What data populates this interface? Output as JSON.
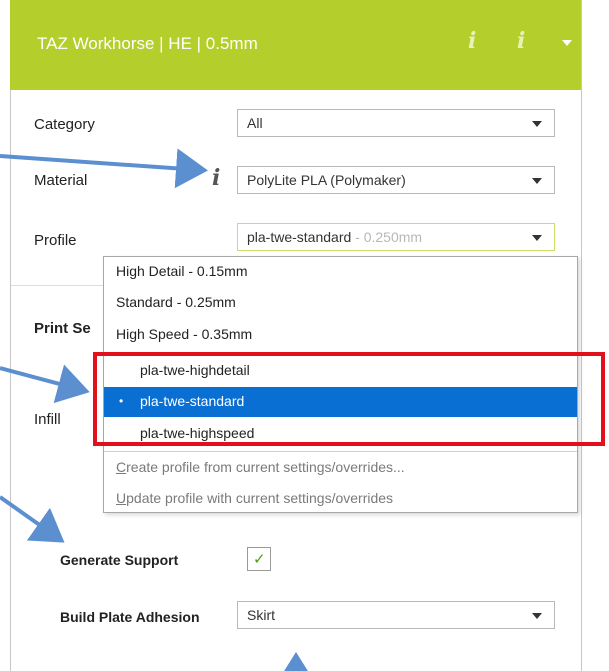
{
  "header": {
    "title": "TAZ Workhorse | HE | 0.5mm",
    "info_glyph": "i",
    "accent": "#b4cf2c"
  },
  "fields": {
    "category_label": "Category",
    "category_value": "All",
    "material_label": "Material",
    "material_value": "PolyLite PLA (Polymaker)",
    "material_info_glyph": "i",
    "profile_label": "Profile",
    "profile_value": "pla-twe-standard",
    "profile_suffix": " - 0.250mm"
  },
  "section": {
    "print_settings_label": "Print Se",
    "infill_label": "Infill"
  },
  "dropdown": {
    "items": [
      "High Detail - 0.15mm",
      "Standard - 0.25mm",
      "High Speed - 0.35mm",
      "pla-twe-highdetail",
      "pla-twe-standard",
      "pla-twe-highspeed"
    ],
    "selected_bullet": "•",
    "actions": [
      "Create profile from current settings/overrides...",
      "Update profile with current settings/overrides"
    ],
    "selected_color": "#0a6fd3",
    "highlight_box_color": "#e2101a"
  },
  "support": {
    "generate_support_label": "Generate Support",
    "checkmark": "✓",
    "build_plate_label": "Build Plate Adhesion",
    "build_plate_value": "Skirt"
  },
  "arrow_color": "#5b8fd0"
}
